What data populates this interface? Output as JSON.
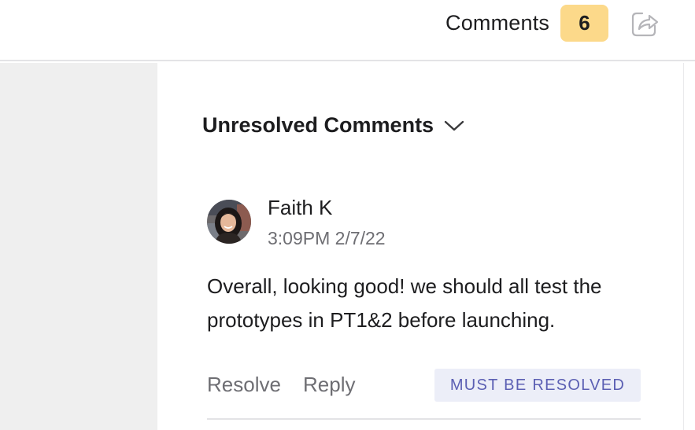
{
  "header": {
    "comments_label": "Comments",
    "comment_count": "6",
    "share_icon": "share-icon"
  },
  "section": {
    "title": "Unresolved Comments",
    "toggle_icon": "chevron-down-icon"
  },
  "comment": {
    "author": "Faith K",
    "timestamp": "3:09PM 2/7/22",
    "body": "Overall, looking good! we should all test the prototypes in PT1&2 before launching.",
    "actions": {
      "resolve": "Resolve",
      "reply": "Reply"
    },
    "status": "MUST BE RESOLVED"
  },
  "colors": {
    "badge_bg": "#fcd98a",
    "status_bg": "#eceef8",
    "status_text": "#5b5fb3",
    "muted_text": "#6e6e73"
  }
}
